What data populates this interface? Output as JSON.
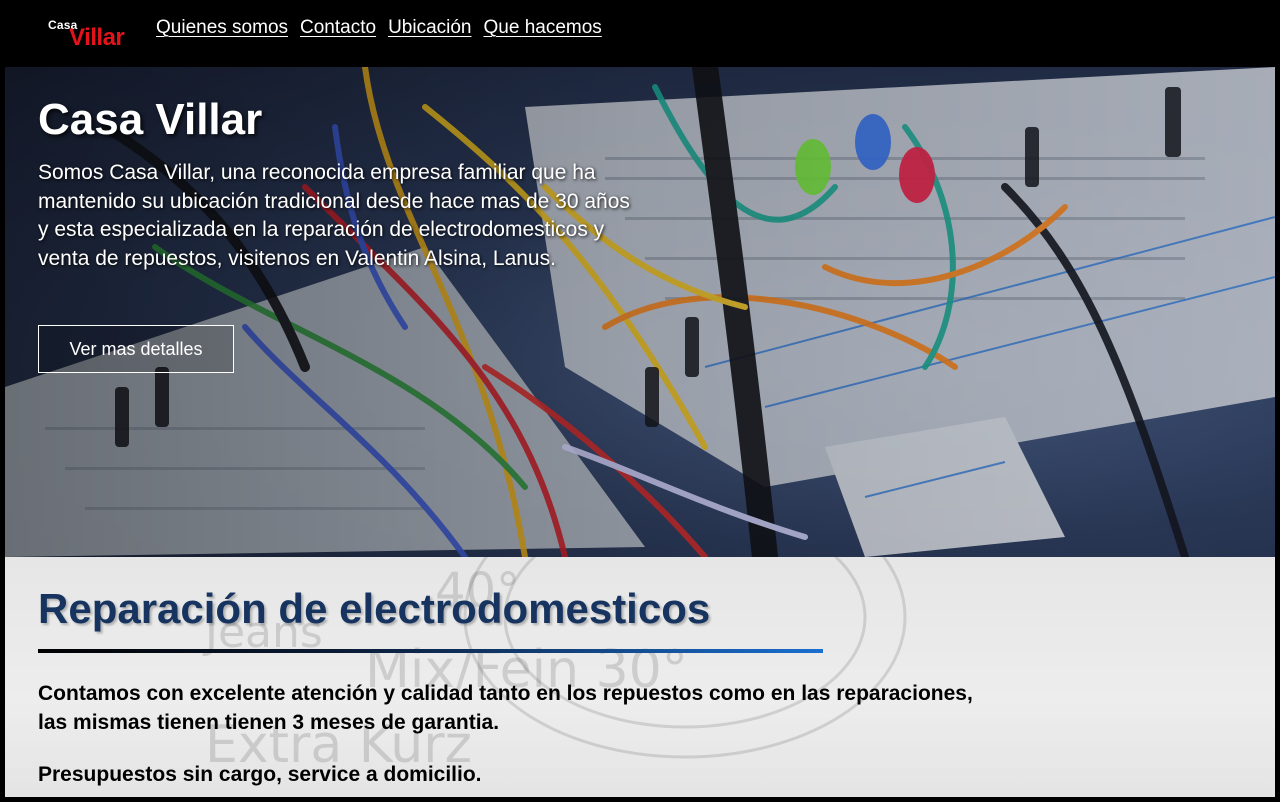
{
  "brand": {
    "logo_small": "Casa",
    "logo_large": "Villar",
    "logo_color": "#e3121b"
  },
  "nav": {
    "items": [
      {
        "label": "Quienes somos"
      },
      {
        "label": "Contacto"
      },
      {
        "label": "Ubicación"
      },
      {
        "label": "Que hacemos"
      }
    ]
  },
  "hero": {
    "title": "Casa Villar",
    "text": "Somos Casa Villar, una reconocida empresa familiar que ha mantenido su ubicación tradicional desde hace mas de 30 años y esta especializada en la reparación de electrodomesticos y venta de repuestos, visitenos en Valentin Alsina, Lanus.",
    "button_label": "Ver mas detalles"
  },
  "section": {
    "title": "Reparación de electrodomesticos",
    "title_color": "#16345f",
    "paragraph_1": "Contamos con excelente atención y calidad tanto en los repuestos como en las reparaciones, las mismas tienen tienen 3 meses de garantia.",
    "paragraph_2": "Presupuestos sin cargo, service a domicilio."
  }
}
